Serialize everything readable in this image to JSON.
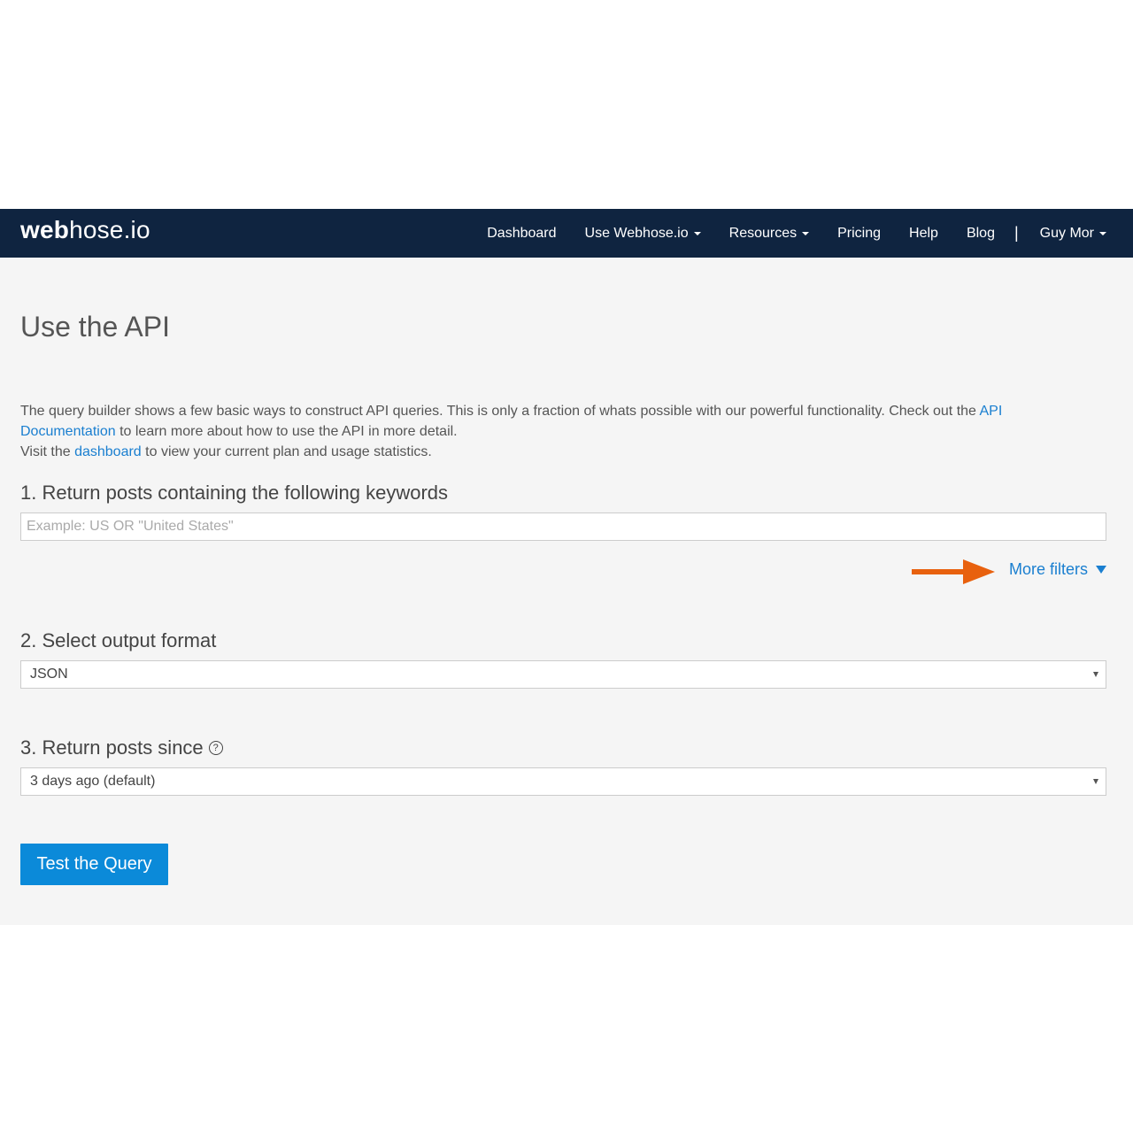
{
  "navbar": {
    "logo_bold": "web",
    "logo_light": "hose.io",
    "items": [
      {
        "label": "Dashboard"
      },
      {
        "label": "Use Webhose.io"
      },
      {
        "label": "Resources"
      },
      {
        "label": "Pricing"
      },
      {
        "label": "Help"
      },
      {
        "label": "Blog"
      }
    ],
    "separator": "|",
    "user": "Guy Mor"
  },
  "page": {
    "title": "Use the API",
    "intro": {
      "text1": "The query builder shows a few basic ways to construct API queries. This is only a fraction of whats possible with our powerful functionality. Check out the ",
      "link1": "API Documentation",
      "text2": " to learn more about how to use the API in more detail.",
      "text3": "Visit the ",
      "link2": "dashboard",
      "text4": " to view your current plan and usage statistics."
    }
  },
  "form": {
    "keywords": {
      "label": "1. Return posts containing the following keywords",
      "placeholder": "Example: US OR \"United States\"",
      "value": ""
    },
    "more_filters": "More filters",
    "format": {
      "label": "2. Select output format",
      "selected": "JSON"
    },
    "since": {
      "label": "3. Return posts since",
      "help": "?",
      "selected": "3 days ago (default)"
    },
    "submit": "Test the Query"
  },
  "colors": {
    "navbar_bg": "#0f2440",
    "link": "#1a7fd0",
    "button": "#0b8ad9",
    "annotation_arrow": "#e8610e",
    "content_bg": "#f5f5f5"
  }
}
